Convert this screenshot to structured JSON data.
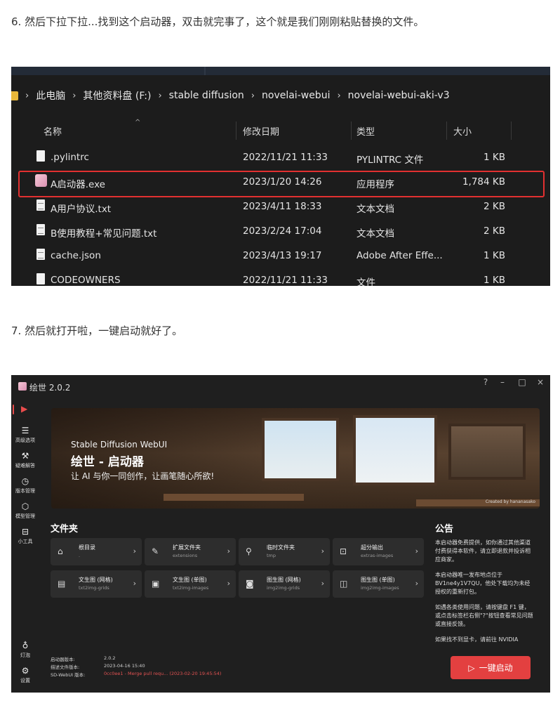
{
  "step6": "6. 然后下拉下拉...找到这个启动器，双击就完事了，这个就是我们刚刚粘贴替换的文件。",
  "step7": "7. 然后就打开啦，一键启动就好了。",
  "explorer": {
    "breadcrumb": [
      "此电脑",
      "其他资料盘 (F:)",
      "stable diffusion",
      "novelai-webui",
      "novelai-webui-aki-v3"
    ],
    "columns": {
      "name": "名称",
      "modified": "修改日期",
      "type": "类型",
      "size": "大小"
    },
    "files": [
      {
        "name": ".pylintrc",
        "modified": "2022/11/21 11:33",
        "type": "PYLINTRC 文件",
        "size": "1 KB",
        "icon": "file"
      },
      {
        "name": "A启动器.exe",
        "modified": "2023/1/20 14:26",
        "type": "应用程序",
        "size": "1,784 KB",
        "icon": "app",
        "highlighted": true
      },
      {
        "name": "A用户协议.txt",
        "modified": "2023/4/11 18:33",
        "type": "文本文档",
        "size": "2 KB",
        "icon": "text"
      },
      {
        "name": "B使用教程+常见问题.txt",
        "modified": "2023/2/24 17:04",
        "type": "文本文档",
        "size": "2 KB",
        "icon": "text"
      },
      {
        "name": "cache.json",
        "modified": "2023/4/13 19:17",
        "type": "Adobe After Effe...",
        "size": "1 KB",
        "icon": "text"
      },
      {
        "name": "CODEOWNERS",
        "modified": "2022/11/21 11:33",
        "type": "文件",
        "size": "1 KB",
        "icon": "file"
      }
    ],
    "highlight_color": "#e23030"
  },
  "launcher": {
    "title": "绘世 2.0.2",
    "window_buttons": [
      "?",
      "–",
      "□",
      "×"
    ],
    "sidebar": [
      {
        "label": "高级选项",
        "icon": "list-icon"
      },
      {
        "label": "疑难解答",
        "icon": "tools-icon"
      },
      {
        "label": "版本管理",
        "icon": "history-icon"
      },
      {
        "label": "模型管理",
        "icon": "cube-icon"
      },
      {
        "label": "小工具",
        "icon": "toolbox-icon"
      },
      {
        "label": "灯泡",
        "icon": "bulb-icon"
      },
      {
        "label": "设置",
        "icon": "gear-icon"
      }
    ],
    "banner": {
      "subtitle": "Stable Diffusion WebUI",
      "title": "绘世 - 启动器",
      "desc": "让 AI 与你一同创作，让画笔随心所欲!",
      "credit": "Created by hananasako"
    },
    "folders_title": "文件夹",
    "folders": [
      {
        "label": "根目录",
        "sub": ".",
        "icon": "root-folder-icon"
      },
      {
        "label": "扩展文件夹",
        "sub": "extensions",
        "icon": "extension-icon"
      },
      {
        "label": "临时文件夹",
        "sub": "tmp",
        "icon": "broom-icon"
      },
      {
        "label": "超分输出",
        "sub": "extras-images",
        "icon": "upscale-icon"
      },
      {
        "label": "文生图 (网格)",
        "sub": "txt2img-grids",
        "icon": "grid-doc-icon"
      },
      {
        "label": "文生图 (单图)",
        "sub": "txt2img-images",
        "icon": "doc-icon"
      },
      {
        "label": "图生图 (网格)",
        "sub": "img2img-grids",
        "icon": "image-grid-icon"
      },
      {
        "label": "图生图 (单图)",
        "sub": "img2img-images",
        "icon": "image-icon"
      }
    ],
    "notice_title": "公告",
    "notices": [
      "本启动器免费提供，如你通过其他渠道付费获得本软件，请立即退款并投诉相应商家。",
      "本启动器唯一发布地点位于BV1ne4y1V7QU，他处下载均为未经授权的重新打包。",
      "如遇各类使用问题，请按键盘 F1 键，或点击标签栏右侧\"?\"按钮查看常见问题或直接反馈。",
      "如果找不到显卡，请前往 NVIDIA"
    ],
    "version": {
      "launcher_label": "启动器版本:",
      "launcher_value": "2.0.2",
      "desc_label": "描述文件版本:",
      "desc_value": "2023-04-16 15:40",
      "webui_label": "SD-WebUI 版本:",
      "webui_value": "0cc0ee1 - Merge pull requ... (2023-02-20 19:45:54)"
    },
    "launch_button": "一键启动",
    "accent_color": "#e34040"
  }
}
